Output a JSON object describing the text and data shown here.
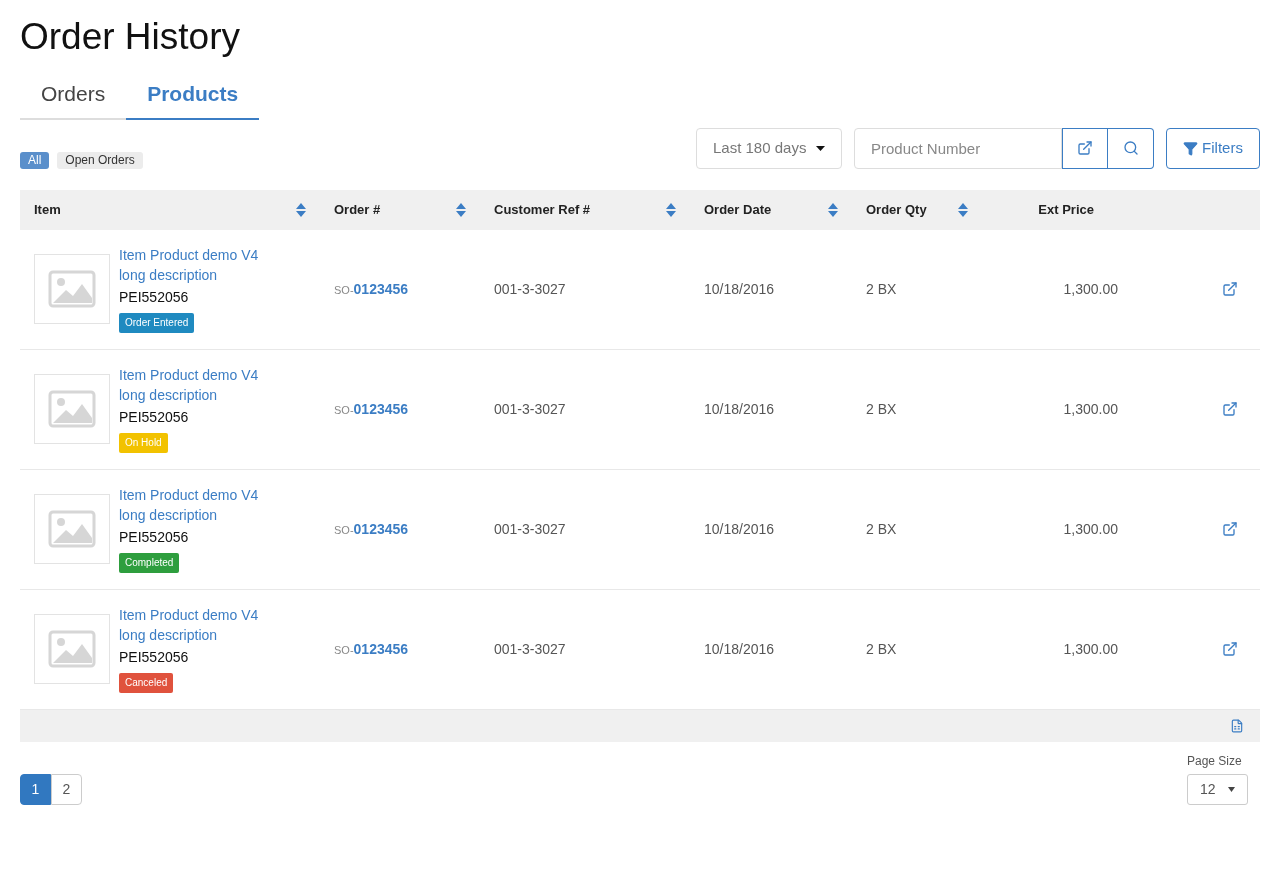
{
  "title": "Order History",
  "tabs": [
    {
      "label": "Orders",
      "selected": false
    },
    {
      "label": "Products",
      "selected": true
    }
  ],
  "filter_pills": [
    {
      "label": "All",
      "selected": true
    },
    {
      "label": "Open Orders",
      "selected": false
    }
  ],
  "date_range": {
    "value": "Last 180 days"
  },
  "search": {
    "placeholder": "Product Number"
  },
  "filters_button": "Filters",
  "table": {
    "columns": [
      {
        "label": "Item",
        "sortable": true
      },
      {
        "label": "Order #",
        "sortable": true
      },
      {
        "label": "Customer Ref #",
        "sortable": true
      },
      {
        "label": "Order Date",
        "sortable": true
      },
      {
        "label": "Order Qty",
        "sortable": true
      },
      {
        "label": "Ext Price",
        "sortable": false
      }
    ],
    "rows": [
      {
        "name": "Item Product demo V4 long description",
        "sku": "PEI552056",
        "status": "Order Entered",
        "color": "#1f8ac0",
        "order_prefix": "SO-",
        "order": "0123456",
        "customer_ref": "001-3-3027",
        "date": "10/18/2016",
        "qty": "2 BX",
        "price": "1,300.00"
      },
      {
        "name": "Item Product demo V4 long description",
        "sku": "PEI552056",
        "status": "On Hold",
        "color": "#f2c200",
        "order_prefix": "SO-",
        "order": "0123456",
        "customer_ref": "001-3-3027",
        "date": "10/18/2016",
        "qty": "2 BX",
        "price": "1,300.00"
      },
      {
        "name": "Item Product demo V4 long description",
        "sku": "PEI552056",
        "status": "Completed",
        "color": "#2e9e3e",
        "order_prefix": "SO-",
        "order": "0123456",
        "customer_ref": "001-3-3027",
        "date": "10/18/2016",
        "qty": "2 BX",
        "price": "1,300.00"
      },
      {
        "name": "Item Product demo V4 long description",
        "sku": "PEI552056",
        "status": "Canceled",
        "color": "#e0523d",
        "order_prefix": "SO-",
        "order": "0123456",
        "customer_ref": "001-3-3027",
        "date": "10/18/2016",
        "qty": "2 BX",
        "price": "1,300.00"
      }
    ]
  },
  "pagination": [
    {
      "label": "1",
      "selected": true
    },
    {
      "label": "2",
      "selected": false
    }
  ],
  "page_size": {
    "label": "Page Size",
    "value": "12"
  }
}
